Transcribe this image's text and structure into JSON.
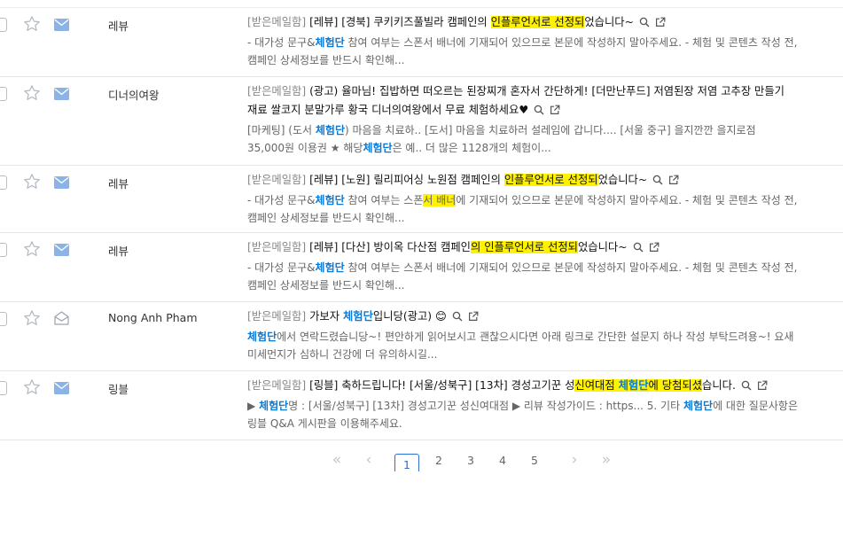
{
  "mails": [
    {
      "sender": "레뷰",
      "folder": "[받은메일함]",
      "subject_parts": [
        {
          "t": "[레뷰] [경북] 쿠키키즈풀빌라 캠페인의 "
        },
        {
          "t": "인플루언서로 선정되",
          "hl": true
        },
        {
          "t": "었습니다~"
        }
      ],
      "snippet_parts": [
        {
          "t": "- 대가성 문구&"
        },
        {
          "t": "체험단",
          "kw": true
        },
        {
          "t": " 참여 여부는 스폰서 배너에 기재되어 있으므로 본문에 작성하지 말아주세요. - 체험 및 콘텐츠 작성 전, 캠페인 상세정보를 반드시 확인해..."
        }
      ],
      "read": false
    },
    {
      "sender": "디너의여왕",
      "folder": "[받은메일함]",
      "subject_parts": [
        {
          "t": "(광고) 율마님! 집밥하면 떠오르는 된장찌개 혼자서 간단하게! [더만난푸드] 저염된장 저염 고추장 만들기 재료 쌀코지 분말가루 황국 디너의여왕에서 무료 체험하세요♥"
        }
      ],
      "snippet_parts": [
        {
          "t": "[마케팅] (도서 "
        },
        {
          "t": "체험단",
          "kw": true
        },
        {
          "t": ") 마음을 치료하.. [도서] 마음을 치료하러 설레임에 갑니다.... [서울 중구] 을지깐깐 을지로점 35,000원 이용권 ★ 해당"
        },
        {
          "t": "체험단",
          "kw": true
        },
        {
          "t": "은 예.. 더 많은 1128개의 체험이..."
        }
      ],
      "read": false
    },
    {
      "sender": "레뷰",
      "folder": "[받은메일함]",
      "subject_parts": [
        {
          "t": "[레뷰] [노원] 릴리피어싱 노원점 캠페인의 "
        },
        {
          "t": "인플루언서로 선정되",
          "hl": true
        },
        {
          "t": "었습니다~"
        }
      ],
      "snippet_parts": [
        {
          "t": "- 대가성 문구&"
        },
        {
          "t": "체험단",
          "kw": true
        },
        {
          "t": " 참여 여부는 스폰"
        },
        {
          "t": "서 배너",
          "hl": true
        },
        {
          "t": "에 기재되어 있으므로 본문에 작성하지 말아주세요. - 체험 및 콘텐츠 작성 전, 캠페인 상세정보를 반드시 확인해..."
        }
      ],
      "read": false
    },
    {
      "sender": "레뷰",
      "folder": "[받은메일함]",
      "subject_parts": [
        {
          "t": "[레뷰] [다산] 방이옥 다산점 캠페인"
        },
        {
          "t": "의 인플루언서로 선정되",
          "hl": true
        },
        {
          "t": "었습니다~"
        }
      ],
      "snippet_parts": [
        {
          "t": "- 대가성 문구&"
        },
        {
          "t": "체험단",
          "kw": true
        },
        {
          "t": " 참여 여부는 스폰서 배너에 기재되어 있으므로 본문에 작성하지 말아주세요. - 체험 및 콘텐츠 작성 전, 캠페인 상세정보를 반드시 확인해..."
        }
      ],
      "read": false
    },
    {
      "sender": "Nong Anh Pham",
      "folder": "[받은메일함]",
      "subject_parts": [
        {
          "t": "가보자 "
        },
        {
          "t": "체험단",
          "kw": true
        },
        {
          "t": "입니당(광고) 😊"
        }
      ],
      "snippet_parts": [
        {
          "t": "체험단",
          "kw": true
        },
        {
          "t": "에서 연락드렸습니당~! 편안하게 읽어보시고 괜찮으시다면 아래 링크로 간단한 설문지 하나 작성 부탁드려용~! 요새 미세먼지가 심하니 건강에 더 유의하시길..."
        }
      ],
      "read": true
    },
    {
      "sender": "링블",
      "folder": "[받은메일함]",
      "subject_parts": [
        {
          "t": "[링블] 축하드립니다! [서울/성북구] [13차] 경성고기꾼 성"
        },
        {
          "t": "신여대점 ",
          "hl": true
        },
        {
          "t": "체험단",
          "hl": true,
          "kw": true
        },
        {
          "t": "에 당첨되셨",
          "hl": true
        },
        {
          "t": "습니다."
        }
      ],
      "snippet_parts": [
        {
          "t": "▶ "
        },
        {
          "t": "체험단",
          "kw": true
        },
        {
          "t": "명 : [서울/성북구] [13차] 경성고기꾼 성신여대점 ▶ 리뷰 작성가이드 : https... 5. 기타 "
        },
        {
          "t": "체험단",
          "kw": true
        },
        {
          "t": "에 대한 질문사항은 링블 Q&A 게시판을 이용해주세요."
        }
      ],
      "read": false
    }
  ],
  "pagination": {
    "first": "«",
    "prev": "‹",
    "pages": [
      "1",
      "2",
      "3",
      "4",
      "5"
    ],
    "current": "1",
    "next": "›",
    "last": "»"
  },
  "colors": {
    "highlight": "#fff200",
    "keyword": "#0b7ad6",
    "unread_mail_icon": "#8ab4e8",
    "read_mail_icon": "#9aa3ad",
    "current_page": "#2a6fd6"
  },
  "icons": {
    "star": "star-outline-icon",
    "mail_unread": "envelope-closed-icon",
    "mail_read": "envelope-open-icon",
    "preview": "magnifier-icon",
    "open_new": "external-link-icon"
  }
}
